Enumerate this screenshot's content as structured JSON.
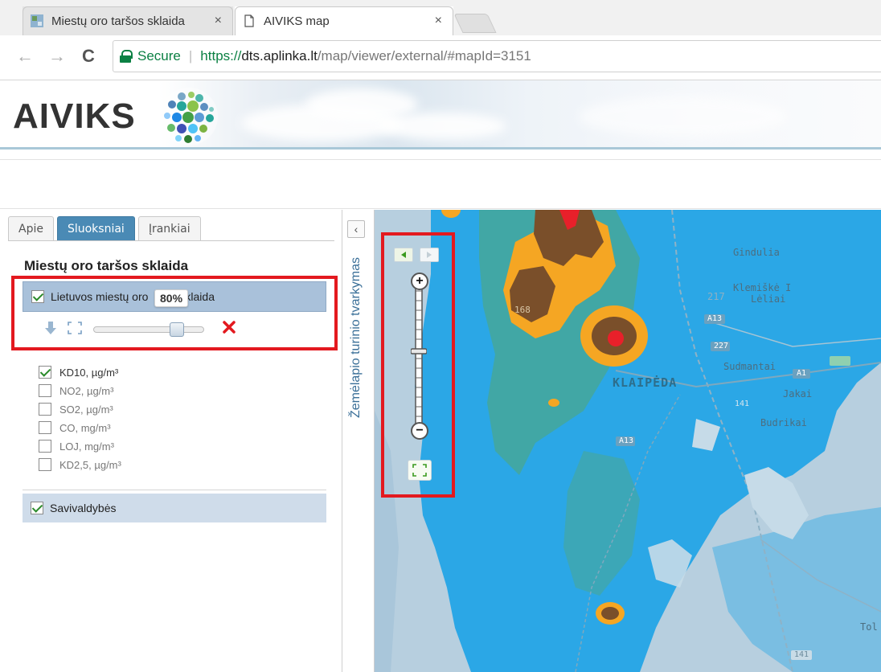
{
  "browser": {
    "tabs": [
      {
        "title": "Miestų oro taršos sklaida",
        "close": "×"
      },
      {
        "title": "AIVIKS map",
        "close": "×"
      }
    ],
    "nav": {
      "back": "←",
      "forward": "→",
      "reload": "C"
    },
    "secure_label": "Secure",
    "url": {
      "scheme": "https://",
      "host": "dts.aplinka.lt",
      "path": "/map/viewer/external/#mapId=3151"
    }
  },
  "header": {
    "logo": "AIVIKS"
  },
  "panel": {
    "tabs": [
      {
        "label": "Apie"
      },
      {
        "label": "Sluoksniai"
      },
      {
        "label": "Įrankiai"
      }
    ],
    "section_title": "Miestų oro taršos sklaida",
    "layer": {
      "label_left": "Lietuvos miestų oro",
      "label_right": "klaida",
      "opacity": "80%",
      "opacity_value": 0.8,
      "checked": true
    },
    "sublayers": [
      {
        "label": "KD10, µg/m³",
        "checked": true
      },
      {
        "label": "NO2, µg/m³",
        "checked": false
      },
      {
        "label": "SO2, µg/m³",
        "checked": false
      },
      {
        "label": "CO, mg/m³",
        "checked": false
      },
      {
        "label": "LOJ, mg/m³",
        "checked": false
      },
      {
        "label": "KD2,5, µg/m³",
        "checked": false
      }
    ],
    "municipalities": {
      "label": "Savivaldybės",
      "checked": true
    }
  },
  "sidebar_strip": {
    "collapse": "‹",
    "title": "Žemėlapio turinio tvarkymas"
  },
  "map": {
    "controls": {
      "zoom_in": "+",
      "zoom_out": "−"
    },
    "city_label": "KLAIPĖDA",
    "place_labels": [
      {
        "text": "Gindulia"
      },
      {
        "text": "Klemiškė I"
      },
      {
        "text": "Lėliai"
      },
      {
        "text": "Sudmantai"
      },
      {
        "text": "Jakai"
      },
      {
        "text": "Budrikai"
      },
      {
        "text": "Tol"
      }
    ],
    "road_labels": [
      "217",
      "A13",
      "227",
      "A1",
      "141",
      "A13",
      "141",
      "168"
    ]
  },
  "colors": {
    "accent": "#4a8ab5",
    "highlight": "#e3191f",
    "map_blue": "#2ba7e6"
  }
}
